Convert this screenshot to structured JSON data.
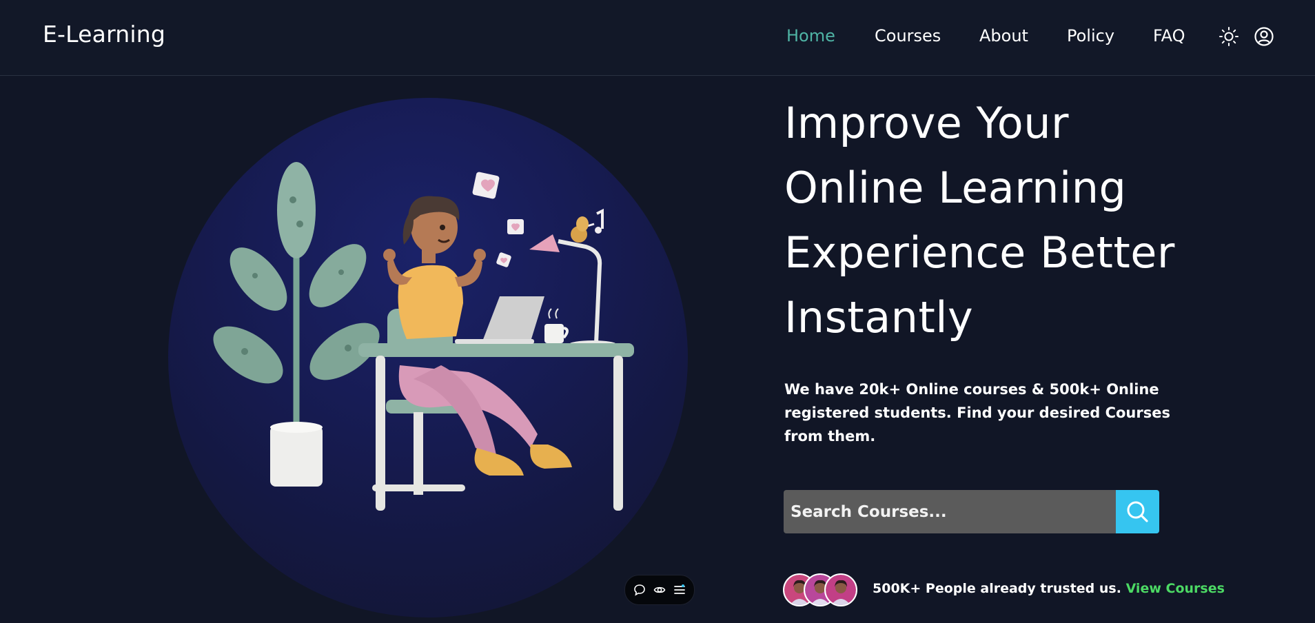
{
  "nav": {
    "brand": "E-Learning",
    "links": [
      {
        "label": "Home",
        "active": true
      },
      {
        "label": "Courses",
        "active": false
      },
      {
        "label": "About",
        "active": false
      },
      {
        "label": "Policy",
        "active": false
      },
      {
        "label": "FAQ",
        "active": false
      }
    ],
    "icons": [
      "sun-icon",
      "user-circle-icon"
    ]
  },
  "hero": {
    "headline_lines": [
      "Improve Your",
      "Online Learning",
      "Experience Better",
      "Instantly"
    ],
    "subtext": "We have 20k+ Online courses & 500k+ Online registered students. Find your desired Courses from them.",
    "search": {
      "placeholder": "Search Courses...",
      "value": "",
      "button_icon": "search-icon"
    },
    "trust": {
      "text": "500K+ People already trusted us.",
      "link": "View Courses"
    }
  },
  "mini_toolbar": {
    "icons": [
      "comment-icon",
      "eye-icon",
      "menu-icon"
    ]
  },
  "colors": {
    "background": "#111626",
    "accent_active": "#4fb4a5",
    "search_button": "#36c5f0",
    "link_green": "#4cd964",
    "circle": "#171c55"
  }
}
